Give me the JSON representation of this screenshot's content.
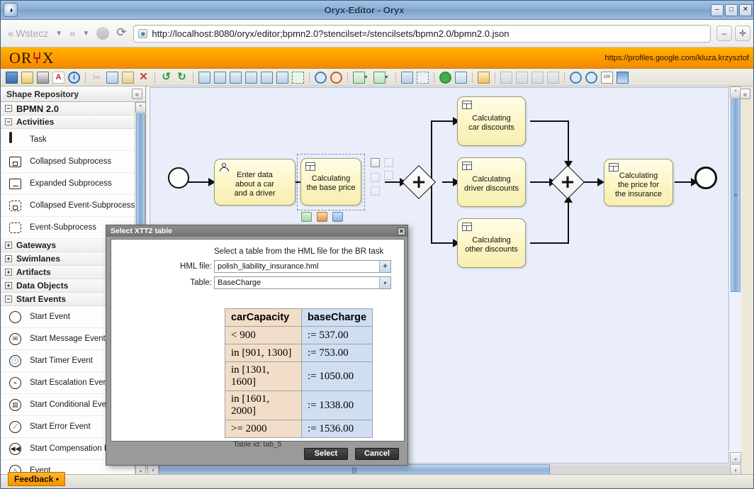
{
  "window": {
    "title": "Oryx-Editor - Oryx",
    "app_icon": "oryx-app-icon",
    "minimize": "–",
    "maximize": "□",
    "close": "✕"
  },
  "browser": {
    "back_label": "Wstecz",
    "forward_label": "",
    "back_dropdown": "▼",
    "forward_dropdown": "▼",
    "stop_label": "",
    "reload_label": "⟳",
    "url": "http://localhost:8080/oryx/editor;bpmn2.0?stencilset=/stencilsets/bpmn2.0/bpmn2.0.json",
    "favicon": "◉",
    "zoom_out": "–",
    "zoom_in": "✛"
  },
  "oryx_header": {
    "logo_left": "OR",
    "logo_horn": "⑂",
    "logo_right": "X",
    "user_profile": "https://profiles.google.com/kluza.krzysztof"
  },
  "toolbar": {
    "buttons": [
      {
        "name": "save-icon",
        "glyph": "💾"
      },
      {
        "name": "save-as-icon",
        "glyph": "📝"
      },
      {
        "name": "print-icon",
        "glyph": "🖨"
      },
      {
        "name": "export-pdf-icon",
        "glyph": "A"
      },
      {
        "name": "info-icon",
        "glyph": "i"
      },
      {
        "name": "separator-1",
        "glyph": ""
      },
      {
        "name": "cut-icon",
        "glyph": "✂"
      },
      {
        "name": "copy-icon",
        "glyph": "⧉"
      },
      {
        "name": "paste-icon",
        "glyph": "📋"
      },
      {
        "name": "delete-icon",
        "glyph": "✕"
      },
      {
        "name": "separator-2",
        "glyph": ""
      },
      {
        "name": "undo-icon",
        "glyph": "↺"
      },
      {
        "name": "redo-icon",
        "glyph": "↻"
      },
      {
        "name": "separator-3",
        "glyph": ""
      },
      {
        "name": "align-bottom-icon",
        "glyph": ""
      },
      {
        "name": "align-middle-icon",
        "glyph": ""
      },
      {
        "name": "align-top-icon",
        "glyph": ""
      },
      {
        "name": "align-left-icon",
        "glyph": ""
      },
      {
        "name": "align-center-icon",
        "glyph": ""
      },
      {
        "name": "align-right-icon",
        "glyph": ""
      },
      {
        "name": "align-same-size-icon",
        "glyph": ""
      },
      {
        "name": "separator-4",
        "glyph": ""
      },
      {
        "name": "zoom-in-icon",
        "glyph": ""
      },
      {
        "name": "zoom-out-icon",
        "glyph": ""
      },
      {
        "name": "separator-5",
        "glyph": ""
      },
      {
        "name": "export-icon",
        "glyph": ""
      },
      {
        "name": "import-icon",
        "glyph": ""
      },
      {
        "name": "separator-6",
        "glyph": ""
      },
      {
        "name": "group-icon",
        "glyph": ""
      },
      {
        "name": "ungroup-icon",
        "glyph": ""
      },
      {
        "name": "separator-7",
        "glyph": ""
      },
      {
        "name": "add-icon",
        "glyph": "＋"
      },
      {
        "name": "new-shape-icon",
        "glyph": ""
      },
      {
        "name": "separator-8",
        "glyph": ""
      },
      {
        "name": "syntax-check-icon",
        "glyph": ""
      },
      {
        "name": "separator-9",
        "glyph": ""
      },
      {
        "name": "bring-front-icon",
        "glyph": ""
      },
      {
        "name": "bring-forward-icon",
        "glyph": ""
      },
      {
        "name": "send-backward-icon",
        "glyph": ""
      },
      {
        "name": "send-back-icon",
        "glyph": ""
      },
      {
        "name": "separator-10",
        "glyph": ""
      },
      {
        "name": "zoom-fit-icon",
        "glyph": ""
      },
      {
        "name": "zoom-actual-icon",
        "glyph": ""
      },
      {
        "name": "percent-icon",
        "glyph": "100"
      },
      {
        "name": "fullscreen-icon",
        "glyph": ""
      }
    ]
  },
  "sidebar": {
    "title": "Shape Repository",
    "collapse_label": "«",
    "feedback_label": "Feedback •",
    "tree": [
      {
        "type": "group",
        "level": 0,
        "expander": "−",
        "label": "BPMN 2.0"
      },
      {
        "type": "group",
        "level": 1,
        "expander": "−",
        "label": "Activities"
      },
      {
        "type": "item",
        "icon": "task-shape-icon",
        "shape": "task",
        "label": "Task"
      },
      {
        "type": "item",
        "icon": "collapsed-subprocess-shape-icon",
        "shape": "coll",
        "label": "Collapsed Subprocess"
      },
      {
        "type": "item",
        "icon": "expanded-subprocess-shape-icon",
        "shape": "exp",
        "label": "Expanded Subprocess"
      },
      {
        "type": "item",
        "icon": "collapsed-event-subprocess-shape-icon",
        "shape": "dash",
        "label": "Collapsed Event-Subprocess"
      },
      {
        "type": "item",
        "icon": "event-subprocess-shape-icon",
        "shape": "dashplain",
        "label": "Event-Subprocess"
      },
      {
        "type": "group",
        "level": 1,
        "expander": "+",
        "label": "Gateways"
      },
      {
        "type": "group",
        "level": 1,
        "expander": "+",
        "label": "Swimlanes"
      },
      {
        "type": "group",
        "level": 1,
        "expander": "+",
        "label": "Artifacts"
      },
      {
        "type": "group",
        "level": 1,
        "expander": "+",
        "label": "Data Objects"
      },
      {
        "type": "group",
        "level": 1,
        "expander": "−",
        "label": "Start Events"
      },
      {
        "type": "item",
        "icon": "start-event-shape-icon",
        "shape": "circle",
        "glyph": "",
        "label": "Start Event"
      },
      {
        "type": "item",
        "icon": "start-message-event-shape-icon",
        "shape": "circle",
        "glyph": "✉",
        "label": "Start Message Event"
      },
      {
        "type": "item",
        "icon": "start-timer-event-shape-icon",
        "shape": "circle",
        "glyph": "🕐",
        "label": "Start Timer Event"
      },
      {
        "type": "item",
        "icon": "start-escalation-event-shape-icon",
        "shape": "circle",
        "glyph": "⌁",
        "label": "Start Escalation Event"
      },
      {
        "type": "item",
        "icon": "start-conditional-event-shape-icon",
        "shape": "circle",
        "glyph": "▤",
        "label": "Start Conditional Event"
      },
      {
        "type": "item",
        "icon": "start-error-event-shape-icon",
        "shape": "circle",
        "glyph": "⟋",
        "label": "Start Error Event"
      },
      {
        "type": "item",
        "icon": "start-compensation-event-shape-icon",
        "shape": "circle",
        "glyph": "◀◀",
        "label": "Start Compensation Ev"
      },
      {
        "type": "item",
        "icon": "start-signal-event-shape-icon",
        "shape": "circle",
        "glyph": "△",
        "label": "Event"
      }
    ]
  },
  "canvas": {
    "right_collapse_label": "«",
    "v_scroll_up": "⌃",
    "v_scroll_down": "⌄",
    "v_thumb_grip": "≡",
    "h_scroll_left": "‹",
    "h_scroll_right": "›",
    "h_thumb_grip": "|||",
    "diagram": {
      "start_event": {
        "name": "start-event"
      },
      "end_event": {
        "name": "end-event"
      },
      "tasks": [
        {
          "id": "t1",
          "label": "Enter data\nabout a car\nand a driver",
          "glyph": "user"
        },
        {
          "id": "t2",
          "label": "Calculating\nthe base price",
          "glyph": "table",
          "selected": true
        },
        {
          "id": "t3",
          "label": "Calculating\ncar discounts",
          "glyph": "table"
        },
        {
          "id": "t4",
          "label": "Calculating\ndriver discounts",
          "glyph": "table"
        },
        {
          "id": "t5",
          "label": "Calculating\nother discounts",
          "glyph": "table"
        },
        {
          "id": "t6",
          "label": "Calculating\nthe price for\nthe insurance",
          "glyph": "table"
        }
      ],
      "gateways": [
        {
          "id": "g1",
          "type": "parallel",
          "symbol": "+"
        },
        {
          "id": "g2",
          "type": "parallel",
          "symbol": "+"
        }
      ]
    }
  },
  "dialog": {
    "title": "Select XTT2 table",
    "close_label": "✕",
    "hint": "Select a table from the HML file for the BR task",
    "hml_label": "HML file:",
    "hml_value": "polish_liability_insurance.hml",
    "hml_add_label": "+",
    "table_label": "Table:",
    "table_value": "BaseCharge",
    "table_caret": "▾",
    "table_id": "Table id: tab_5",
    "select_button": "Select",
    "cancel_button": "Cancel",
    "xtt_table": {
      "headers": [
        "carCapacity",
        "baseCharge"
      ],
      "rows": [
        [
          "< 900",
          ":= 537.00"
        ],
        [
          "in [901, 1300]",
          ":= 753.00"
        ],
        [
          "in [1301, 1600]",
          ":= 1050.00"
        ],
        [
          "in [1601, 2000]",
          ":= 1338.00"
        ],
        [
          ">= 2000",
          ":= 1536.00"
        ]
      ]
    }
  },
  "colors": {
    "oryx_orange": "#ff9c00",
    "titlebar_blue": "#8aaed3",
    "canvas_bg": "#eaeefb",
    "task_fill": "#fcf5c4",
    "xtt_col1": "#f2ddc9",
    "xtt_col2": "#cfdef0"
  }
}
